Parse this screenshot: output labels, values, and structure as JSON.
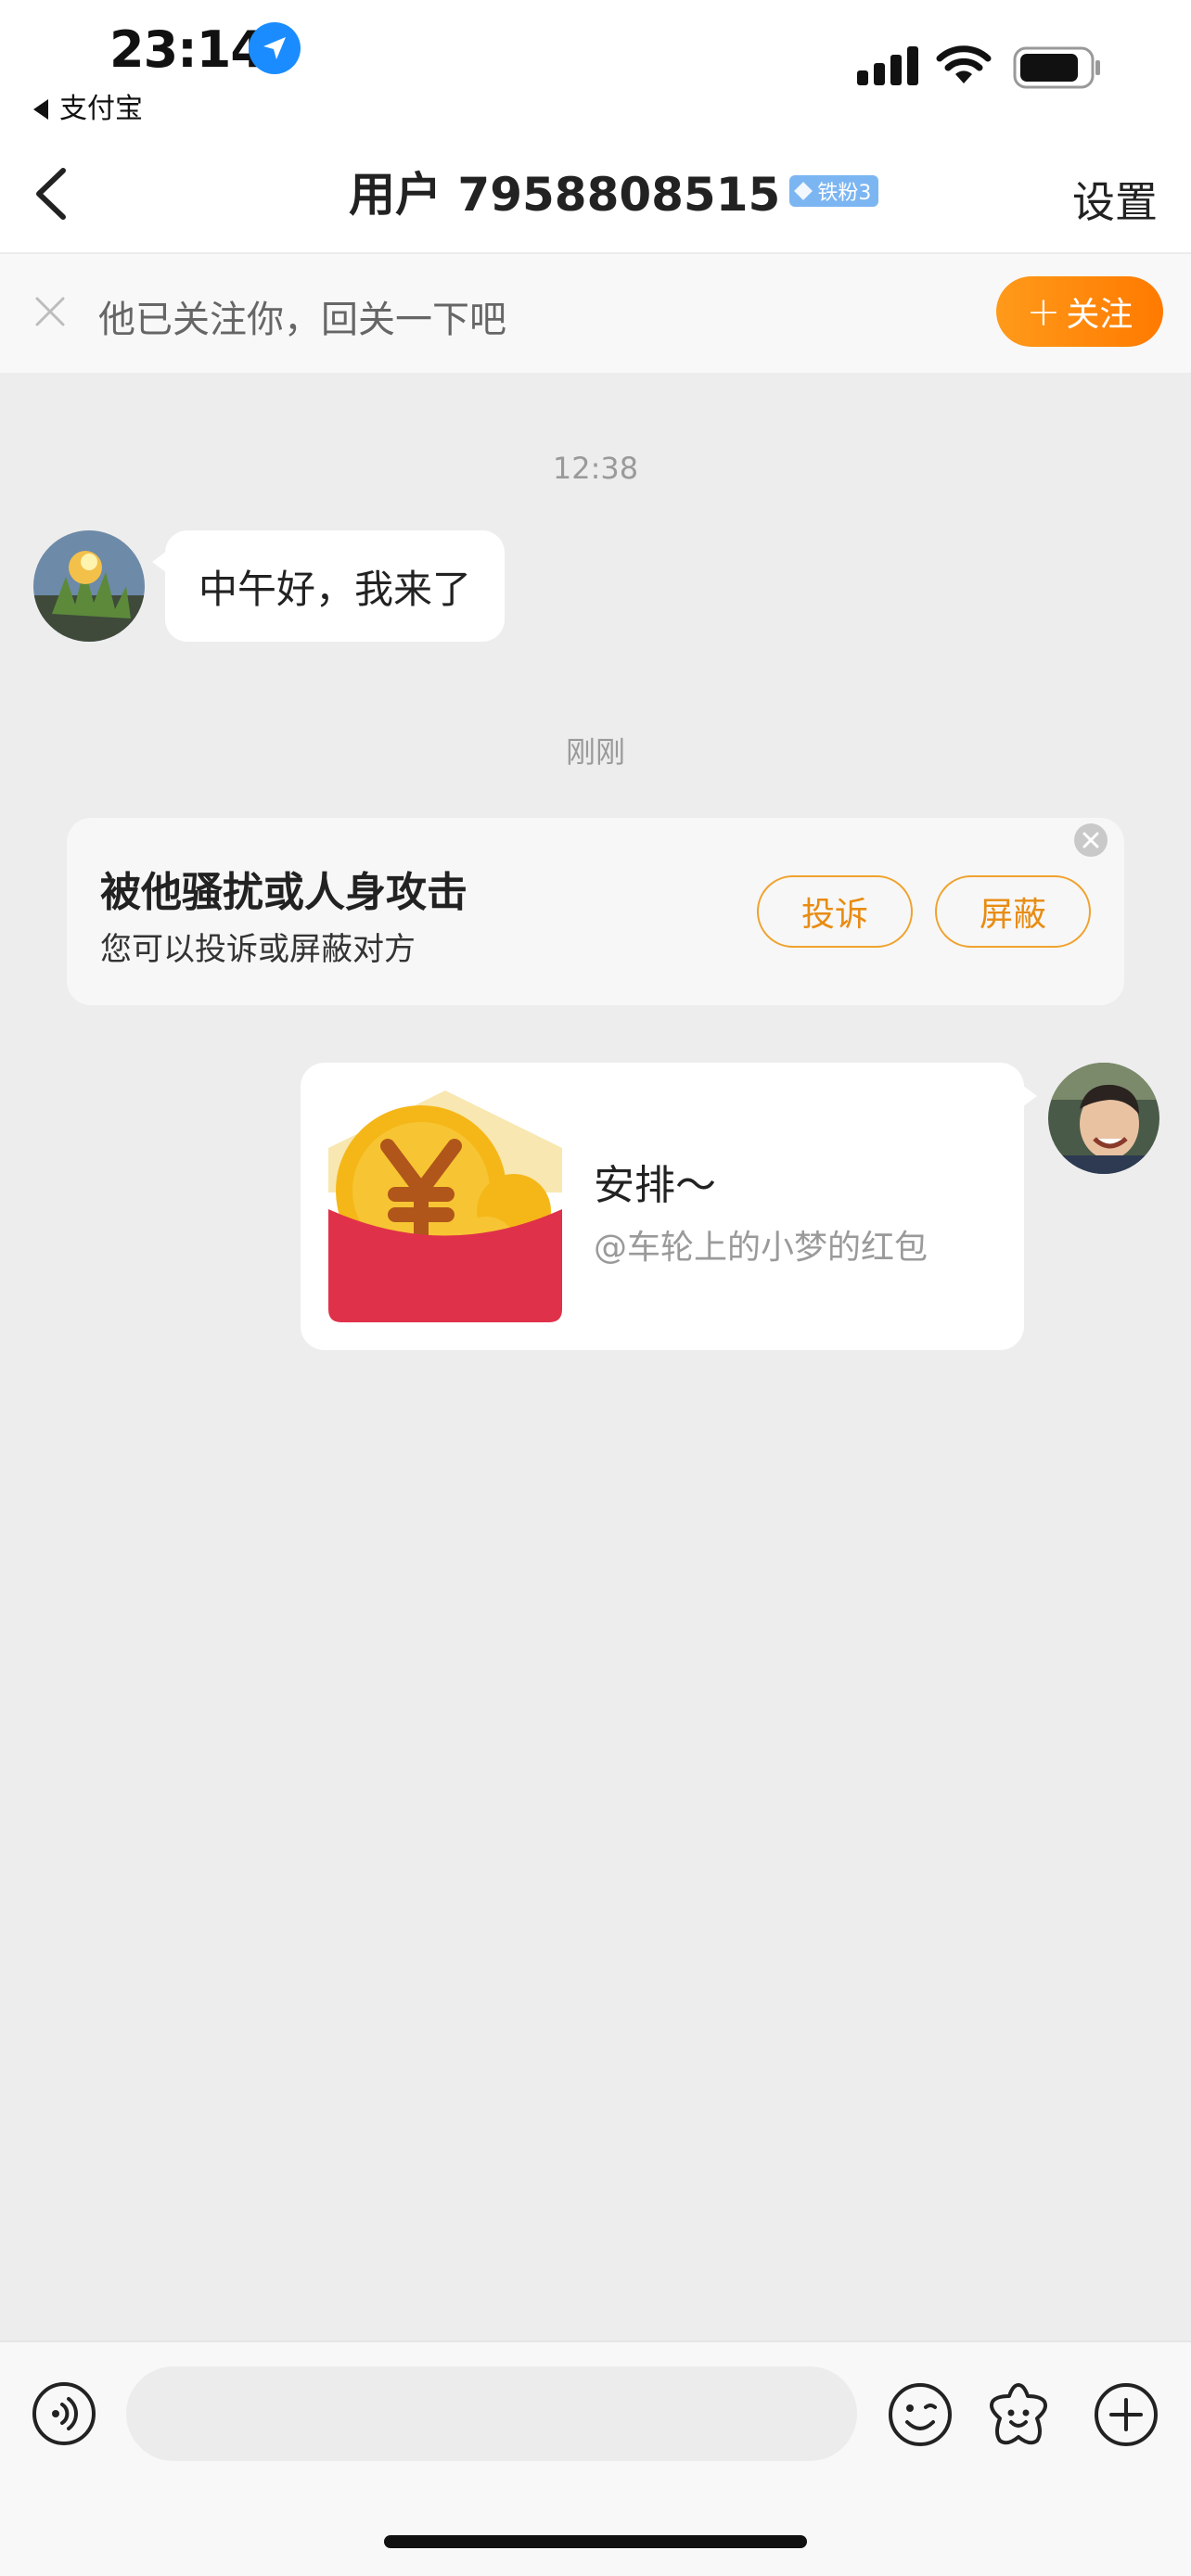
{
  "status_bar": {
    "time": "23:14",
    "back_app": "支付宝",
    "icons": [
      "location-arrow-icon",
      "cellular-signal-icon",
      "wifi-icon",
      "battery-icon"
    ]
  },
  "nav": {
    "back_icon": "chevron-left-icon",
    "title": "用户 7958808515",
    "badge": "铁粉3",
    "settings": "设置"
  },
  "follow_banner": {
    "text": "他已关注你，回关一下吧",
    "button": "关注"
  },
  "chat": {
    "timestamp_1": "12:38",
    "incoming_message": "中午好，我来了",
    "timestamp_2": "刚刚",
    "harassment_notice": {
      "title": "被他骚扰或人身攻击",
      "subtitle": "您可以投诉或屏蔽对方",
      "report_button": "投诉",
      "block_button": "屏蔽"
    },
    "red_packet": {
      "title": "安排～",
      "subtitle": "@车轮上的小梦的红包"
    }
  },
  "input_bar": {
    "icons": [
      "voice-icon",
      "emoji-icon",
      "sticker-icon",
      "plus-icon"
    ]
  },
  "colors": {
    "accent_orange": "#ff8a00",
    "badge_blue": "#7cb6f2",
    "red_packet": "#e0314a",
    "coin_gold": "#f5b718"
  }
}
